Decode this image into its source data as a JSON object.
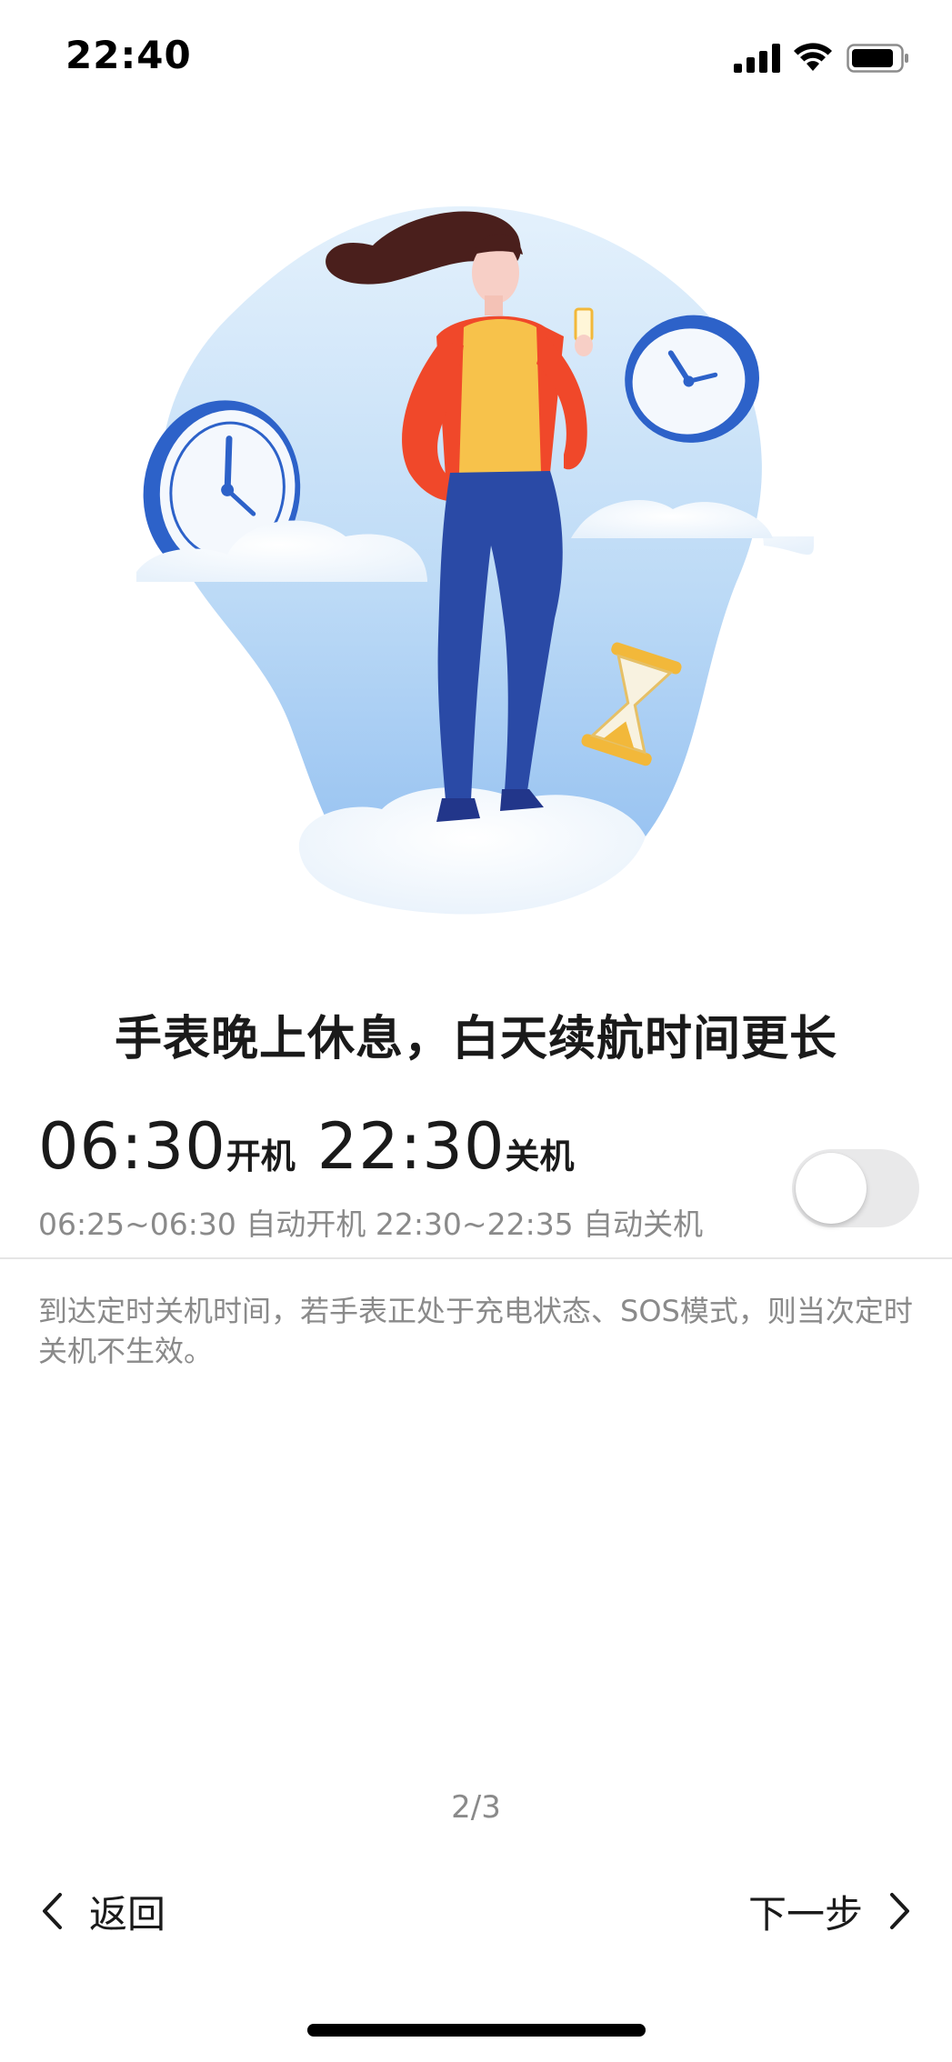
{
  "status_bar": {
    "time": "22:40"
  },
  "illustration": {
    "name": "woman-with-clocks-illustration",
    "colors": {
      "blob": "#bfdcf7",
      "shirt": "#f0482a",
      "vest": "#f7c24b",
      "jeans": "#2a4aa6",
      "hair": "#4a1f1c"
    }
  },
  "headline": "手表晚上休息，白天续航时间更长",
  "schedule": {
    "on_time": "06:30",
    "on_label": "开机",
    "off_time": "22:30",
    "off_label": "关机",
    "detail": "06:25~06:30 自动开机 22:30~22:35 自动关机",
    "enabled": false
  },
  "note": "到达定时关机时间，若手表正处于充电状态、SOS模式，则当次定时关机不生效。",
  "pager": "2/3",
  "nav": {
    "back_label": "返回",
    "next_label": "下一步"
  }
}
